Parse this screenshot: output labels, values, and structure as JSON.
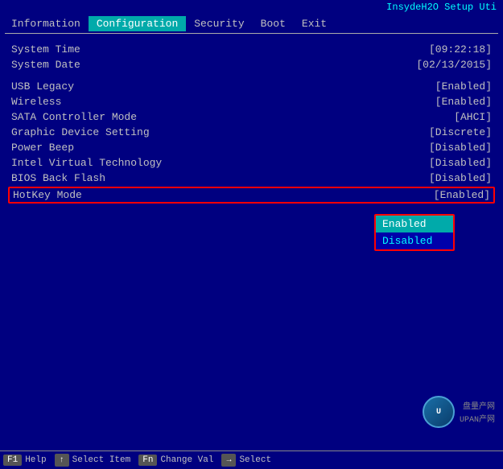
{
  "topbar": {
    "title": "InsydeH2O Setup Uti"
  },
  "menu": {
    "items": [
      {
        "label": "Information",
        "active": false
      },
      {
        "label": "Configuration",
        "active": true
      },
      {
        "label": "Security",
        "active": false
      },
      {
        "label": "Boot",
        "active": false
      },
      {
        "label": "Exit",
        "active": false
      }
    ]
  },
  "settings": [
    {
      "label": "System Time",
      "value": "[09:22:18]"
    },
    {
      "label": "System Date",
      "value": "[02/13/2015]"
    },
    {
      "label": "",
      "value": ""
    },
    {
      "label": "USB Legacy",
      "value": "[Enabled]"
    },
    {
      "label": "Wireless",
      "value": "[Enabled]"
    },
    {
      "label": "SATA Controller Mode",
      "value": "[AHCI]"
    },
    {
      "label": "Graphic Device Setting",
      "value": "[Discrete]"
    },
    {
      "label": "Power Beep",
      "value": "[Disabled]"
    },
    {
      "label": "Intel Virtual Technology",
      "value": "[Disabled]"
    },
    {
      "label": "BIOS Back Flash",
      "value": "[Disabled]"
    }
  ],
  "hotkey_row": {
    "label": "HotKey Mode",
    "value": "[Enabled]"
  },
  "dropdown": {
    "items": [
      {
        "label": "Enabled",
        "highlighted": true
      },
      {
        "label": "Disabled",
        "highlighted": false
      }
    ]
  },
  "bottombar": {
    "help_label": "Help",
    "select_label": "Select Item",
    "change_label": "Change Val",
    "select2_label": "Select",
    "f1_key": "F1",
    "fn_key": "Fn"
  },
  "watermark": {
    "text": "盘量产网",
    "subtext": "UPAN产网"
  }
}
